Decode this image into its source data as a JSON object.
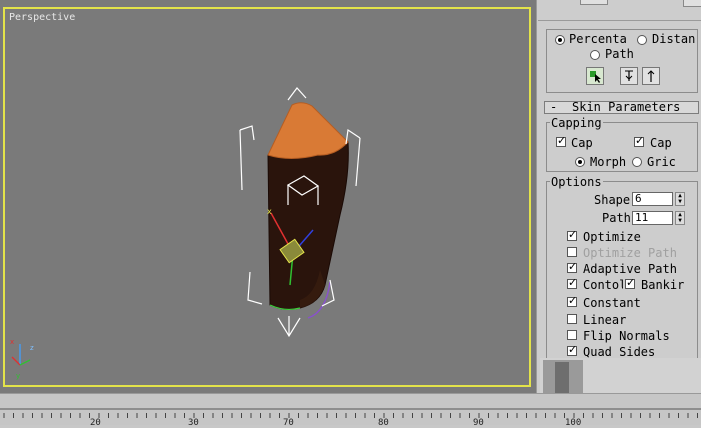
{
  "viewport": {
    "label": "Perspective",
    "background": "#7a7a7a",
    "border_color": "#e3e34a"
  },
  "panel": {
    "path_params": {
      "percentage_label": "Percenta",
      "distance_label": "Distan",
      "path_label": "Path",
      "selected": "percentage"
    },
    "skin_parameters": {
      "title": "Skin Parameters",
      "collapse_symbol": "-",
      "capping": {
        "title": "Capping",
        "cap_start_label": "Cap",
        "cap_start": true,
        "cap_end_label": "Cap",
        "cap_end": true,
        "morph_label": "Morph",
        "grid_label": "Gric",
        "selected": "morph"
      },
      "options": {
        "title": "Options",
        "shape_steps_label": "Shape",
        "shape_steps_value": "6",
        "path_steps_label": "Path",
        "path_steps_value": "11",
        "optimize_label": "Optimize",
        "optimize": true,
        "optimize_path_label": "Optimize Path",
        "optimize_path": false,
        "adaptive_path_label": "Adaptive Path",
        "adaptive_path": true,
        "contour_label": "Contol",
        "contour": true,
        "banking_label": "Bankir",
        "banking": true,
        "constant_label": "Constant",
        "constant": true,
        "linear_label": "Linear",
        "linear": false,
        "flip_normals_label": "Flip Normals",
        "flip_normals": false,
        "quad_sides_label": "Quad Sides",
        "quad_sides": true
      }
    }
  },
  "timeline": {
    "tick_labels": [
      "20",
      "30",
      "70",
      "80",
      "90",
      "100"
    ]
  },
  "colors": {
    "object_body": "#2a140c",
    "object_cap": "#d97a35",
    "gizmo": "#ffffff",
    "selection_box": "#8a8a3a"
  },
  "icons": [
    "axis-tripod-icon",
    "pick-path-icon",
    "next-shape-icon",
    "previous-shape-icon"
  ]
}
